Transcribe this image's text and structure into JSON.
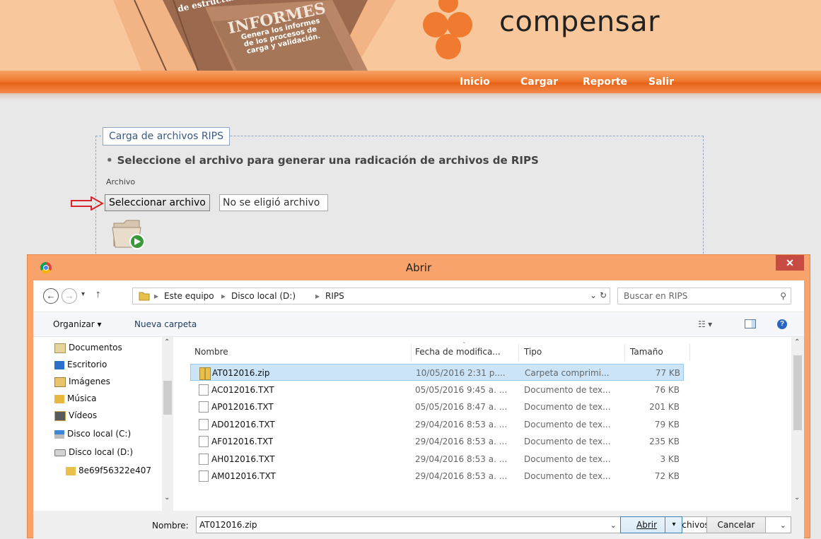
{
  "header": {
    "banner_title": "INFORMES",
    "banner_top_text": "de estructura y",
    "banner_sub": [
      "Genera los informes",
      "de los procesos de",
      "carga y validación."
    ],
    "brand": "compensar",
    "brand_color": "#f07a2f"
  },
  "nav": {
    "items": [
      {
        "label": "Inicio"
      },
      {
        "label": "Cargar"
      },
      {
        "label": "Reporte"
      },
      {
        "label": "Salir"
      }
    ]
  },
  "upload_form": {
    "legend": "Carga de archivos RIPS",
    "instruction": "Seleccione el archivo para generar una radicación de archivos de RIPS",
    "field_label": "Archivo",
    "choose_button": "Seleccionar archivo",
    "no_file_text": "No se eligió archivo"
  },
  "dialog": {
    "title": "Abrir",
    "close_glyph": "✕",
    "breadcrumb": [
      "Este equipo",
      "Disco local (D:)",
      "RIPS"
    ],
    "search_placeholder": "Buscar en RIPS",
    "toolbar": {
      "organize": "Organizar ▾",
      "new_folder": "Nueva carpeta"
    },
    "nav_items": [
      {
        "label": "Documentos",
        "icon": "documents-icon"
      },
      {
        "label": "Escritorio",
        "icon": "desktop-icon"
      },
      {
        "label": "Imágenes",
        "icon": "pictures-icon"
      },
      {
        "label": "Música",
        "icon": "music-icon"
      },
      {
        "label": "Vídeos",
        "icon": "videos-icon"
      },
      {
        "label": "Disco local (C:)",
        "icon": "drive-c-icon"
      },
      {
        "label": "Disco local (D:)",
        "icon": "drive-d-icon"
      },
      {
        "label": "8e69f56322e407",
        "icon": "folder-icon"
      }
    ],
    "columns": {
      "name": "Nombre",
      "date": "Fecha de modifica...",
      "type": "Tipo",
      "size": "Tamaño"
    },
    "files": [
      {
        "name": "AT012016.zip",
        "date": "10/05/2016 2:31 p....",
        "type": "Carpeta comprimi...",
        "size": "77 KB",
        "selected": true,
        "icon": "zip-folder-icon"
      },
      {
        "name": "AC012016.TXT",
        "date": "05/05/2016 9:45 a. ...",
        "type": "Documento de tex...",
        "size": "76 KB",
        "icon": "text-file-icon"
      },
      {
        "name": "AP012016.TXT",
        "date": "05/05/2016 8:47 a. ...",
        "type": "Documento de tex...",
        "size": "201 KB",
        "icon": "text-file-icon"
      },
      {
        "name": "AD012016.TXT",
        "date": "29/04/2016 8:53 a. ...",
        "type": "Documento de tex...",
        "size": "79 KB",
        "icon": "text-file-icon"
      },
      {
        "name": "AF012016.TXT",
        "date": "29/04/2016 8:53 a. ...",
        "type": "Documento de tex...",
        "size": "235 KB",
        "icon": "text-file-icon"
      },
      {
        "name": "AH012016.TXT",
        "date": "29/04/2016 8:53 a. ...",
        "type": "Documento de tex...",
        "size": "3 KB",
        "icon": "text-file-icon"
      },
      {
        "name": "AM012016.TXT",
        "date": "29/04/2016 8:53 a. ...",
        "type": "Documento de tex...",
        "size": "72 KB",
        "icon": "text-file-icon"
      }
    ],
    "filename_label": "Nombre:",
    "filename_value": "AT012016.zip",
    "filter_value": "Todos los archivos",
    "open_button": "Abrir",
    "cancel_button": "Cancelar"
  }
}
